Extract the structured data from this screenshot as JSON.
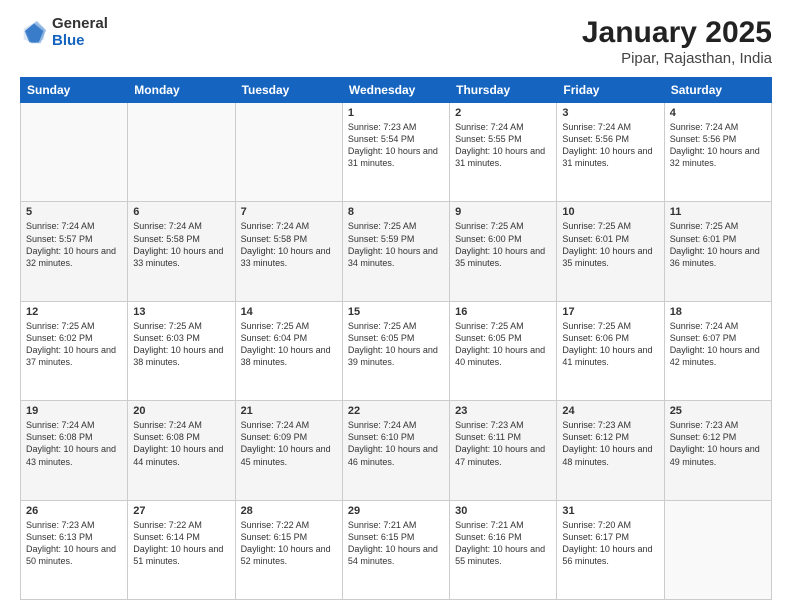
{
  "logo": {
    "general": "General",
    "blue": "Blue"
  },
  "header": {
    "title": "January 2025",
    "subtitle": "Pipar, Rajasthan, India"
  },
  "weekdays": [
    "Sunday",
    "Monday",
    "Tuesday",
    "Wednesday",
    "Thursday",
    "Friday",
    "Saturday"
  ],
  "weeks": [
    [
      {
        "day": "",
        "info": ""
      },
      {
        "day": "",
        "info": ""
      },
      {
        "day": "",
        "info": ""
      },
      {
        "day": "1",
        "info": "Sunrise: 7:23 AM\nSunset: 5:54 PM\nDaylight: 10 hours\nand 31 minutes."
      },
      {
        "day": "2",
        "info": "Sunrise: 7:24 AM\nSunset: 5:55 PM\nDaylight: 10 hours\nand 31 minutes."
      },
      {
        "day": "3",
        "info": "Sunrise: 7:24 AM\nSunset: 5:56 PM\nDaylight: 10 hours\nand 31 minutes."
      },
      {
        "day": "4",
        "info": "Sunrise: 7:24 AM\nSunset: 5:56 PM\nDaylight: 10 hours\nand 32 minutes."
      }
    ],
    [
      {
        "day": "5",
        "info": "Sunrise: 7:24 AM\nSunset: 5:57 PM\nDaylight: 10 hours\nand 32 minutes."
      },
      {
        "day": "6",
        "info": "Sunrise: 7:24 AM\nSunset: 5:58 PM\nDaylight: 10 hours\nand 33 minutes."
      },
      {
        "day": "7",
        "info": "Sunrise: 7:24 AM\nSunset: 5:58 PM\nDaylight: 10 hours\nand 33 minutes."
      },
      {
        "day": "8",
        "info": "Sunrise: 7:25 AM\nSunset: 5:59 PM\nDaylight: 10 hours\nand 34 minutes."
      },
      {
        "day": "9",
        "info": "Sunrise: 7:25 AM\nSunset: 6:00 PM\nDaylight: 10 hours\nand 35 minutes."
      },
      {
        "day": "10",
        "info": "Sunrise: 7:25 AM\nSunset: 6:01 PM\nDaylight: 10 hours\nand 35 minutes."
      },
      {
        "day": "11",
        "info": "Sunrise: 7:25 AM\nSunset: 6:01 PM\nDaylight: 10 hours\nand 36 minutes."
      }
    ],
    [
      {
        "day": "12",
        "info": "Sunrise: 7:25 AM\nSunset: 6:02 PM\nDaylight: 10 hours\nand 37 minutes."
      },
      {
        "day": "13",
        "info": "Sunrise: 7:25 AM\nSunset: 6:03 PM\nDaylight: 10 hours\nand 38 minutes."
      },
      {
        "day": "14",
        "info": "Sunrise: 7:25 AM\nSunset: 6:04 PM\nDaylight: 10 hours\nand 38 minutes."
      },
      {
        "day": "15",
        "info": "Sunrise: 7:25 AM\nSunset: 6:05 PM\nDaylight: 10 hours\nand 39 minutes."
      },
      {
        "day": "16",
        "info": "Sunrise: 7:25 AM\nSunset: 6:05 PM\nDaylight: 10 hours\nand 40 minutes."
      },
      {
        "day": "17",
        "info": "Sunrise: 7:25 AM\nSunset: 6:06 PM\nDaylight: 10 hours\nand 41 minutes."
      },
      {
        "day": "18",
        "info": "Sunrise: 7:24 AM\nSunset: 6:07 PM\nDaylight: 10 hours\nand 42 minutes."
      }
    ],
    [
      {
        "day": "19",
        "info": "Sunrise: 7:24 AM\nSunset: 6:08 PM\nDaylight: 10 hours\nand 43 minutes."
      },
      {
        "day": "20",
        "info": "Sunrise: 7:24 AM\nSunset: 6:08 PM\nDaylight: 10 hours\nand 44 minutes."
      },
      {
        "day": "21",
        "info": "Sunrise: 7:24 AM\nSunset: 6:09 PM\nDaylight: 10 hours\nand 45 minutes."
      },
      {
        "day": "22",
        "info": "Sunrise: 7:24 AM\nSunset: 6:10 PM\nDaylight: 10 hours\nand 46 minutes."
      },
      {
        "day": "23",
        "info": "Sunrise: 7:23 AM\nSunset: 6:11 PM\nDaylight: 10 hours\nand 47 minutes."
      },
      {
        "day": "24",
        "info": "Sunrise: 7:23 AM\nSunset: 6:12 PM\nDaylight: 10 hours\nand 48 minutes."
      },
      {
        "day": "25",
        "info": "Sunrise: 7:23 AM\nSunset: 6:12 PM\nDaylight: 10 hours\nand 49 minutes."
      }
    ],
    [
      {
        "day": "26",
        "info": "Sunrise: 7:23 AM\nSunset: 6:13 PM\nDaylight: 10 hours\nand 50 minutes."
      },
      {
        "day": "27",
        "info": "Sunrise: 7:22 AM\nSunset: 6:14 PM\nDaylight: 10 hours\nand 51 minutes."
      },
      {
        "day": "28",
        "info": "Sunrise: 7:22 AM\nSunset: 6:15 PM\nDaylight: 10 hours\nand 52 minutes."
      },
      {
        "day": "29",
        "info": "Sunrise: 7:21 AM\nSunset: 6:15 PM\nDaylight: 10 hours\nand 54 minutes."
      },
      {
        "day": "30",
        "info": "Sunrise: 7:21 AM\nSunset: 6:16 PM\nDaylight: 10 hours\nand 55 minutes."
      },
      {
        "day": "31",
        "info": "Sunrise: 7:20 AM\nSunset: 6:17 PM\nDaylight: 10 hours\nand 56 minutes."
      },
      {
        "day": "",
        "info": ""
      }
    ]
  ]
}
